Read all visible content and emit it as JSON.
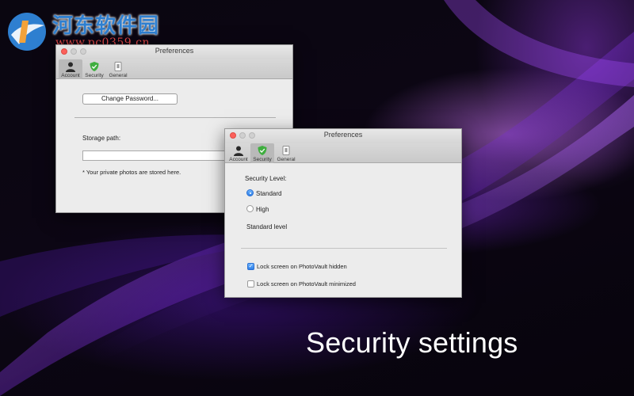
{
  "watermark": {
    "title": "河东软件园",
    "url": "www.pc0359.cn"
  },
  "back_window": {
    "title": "Preferences",
    "tabs": [
      {
        "label": "Account",
        "icon": "person-icon",
        "selected": true
      },
      {
        "label": "Security",
        "icon": "shield-icon",
        "selected": false
      },
      {
        "label": "General",
        "icon": "switch-icon",
        "selected": false
      }
    ],
    "change_password_label": "Change Password...",
    "storage_label": "Storage path:",
    "storage_value": "",
    "storage_note": "* Your private photos are stored here."
  },
  "front_window": {
    "title": "Preferences",
    "tabs": [
      {
        "label": "Account",
        "icon": "person-icon",
        "selected": false
      },
      {
        "label": "Security",
        "icon": "shield-icon",
        "selected": true
      },
      {
        "label": "General",
        "icon": "switch-icon",
        "selected": false
      }
    ],
    "security_level_label": "Security Level:",
    "options": [
      {
        "label": "Standard",
        "selected": true
      },
      {
        "label": "High",
        "selected": false
      }
    ],
    "level_description": "Standard level",
    "checkboxes": [
      {
        "label": "Lock screen on PhotoVault hidden",
        "checked": true
      },
      {
        "label": "Lock screen on PhotoVault minimized",
        "checked": false
      }
    ]
  },
  "caption": "Security settings",
  "colors": {
    "accent": "#2e7fe6",
    "close_button": "#fc605b",
    "shield": "#3fae3f",
    "watermark_title": "#2e7fd0",
    "watermark_url": "#e04848"
  }
}
